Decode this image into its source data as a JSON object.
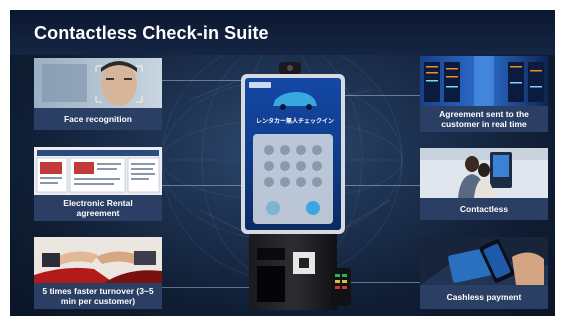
{
  "slide": {
    "title": "Contactless Check-in Suite"
  },
  "features": [
    {
      "label": "Face recognition",
      "icon": "face-scan-photo"
    },
    {
      "label": "Electronic Rental agreement",
      "icon": "document-screen-photo"
    },
    {
      "label": "5 times faster turnover (3~5 min per customer)",
      "icon": "handshake-photo"
    },
    {
      "label": "Agreement sent to the customer in real time",
      "icon": "server-room-photo"
    },
    {
      "label": "Contactless",
      "icon": "kiosk-user-photo"
    },
    {
      "label": "Cashless payment",
      "icon": "phone-payment-photo"
    }
  ],
  "kiosk": {
    "screen_heading": "レンタカー無人チェックイン"
  },
  "colors": {
    "background": "#1d3150",
    "title_bar": "#0c1730",
    "caption_bar": "#2a3f63",
    "kiosk_screen": "#0f3d8a",
    "keypad_button": "#3aa8e0"
  }
}
